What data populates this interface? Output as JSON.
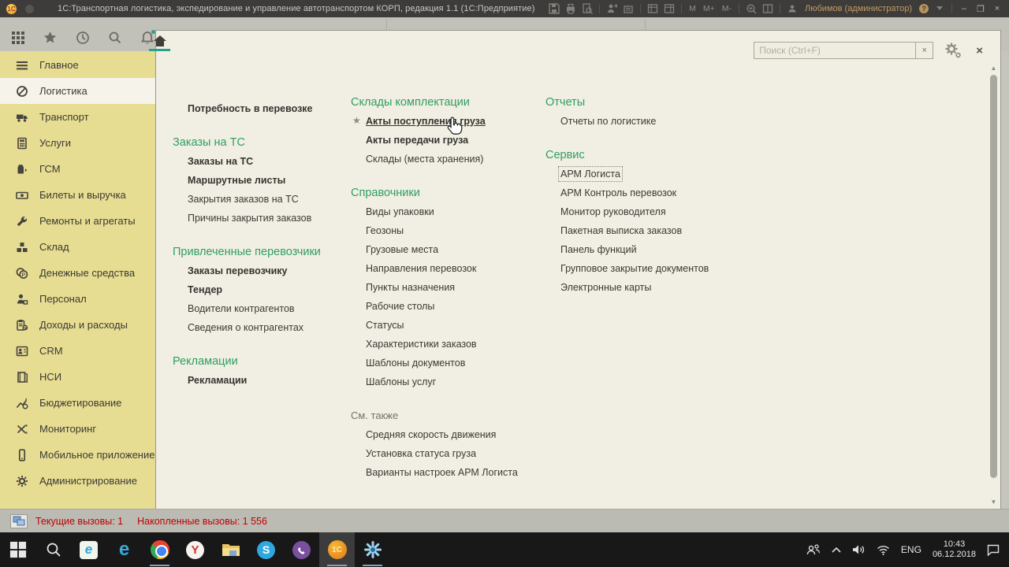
{
  "titlebar": {
    "logo": "1С",
    "title": "1С:Транспортная логистика, экспедирование и управление автотранспортом КОРП, редакция 1.1  (1С:Предприятие)",
    "memory_buttons": [
      "M",
      "M+",
      "M-"
    ],
    "user": "Любимов (администратор)",
    "help": "?",
    "minimize": "–",
    "maximize": "❒",
    "close": "×"
  },
  "panel": {
    "search_placeholder": "Поиск (Ctrl+F)",
    "search_clear": "×",
    "close": "×",
    "scroll_up": "▲",
    "scroll_down": "▼"
  },
  "sidebar": [
    {
      "label": "Главное",
      "icon": "menu-icon"
    },
    {
      "label": "Логистика",
      "icon": "compass-icon",
      "selected": true
    },
    {
      "label": "Транспорт",
      "icon": "truck-icon"
    },
    {
      "label": "Услуги",
      "icon": "calculator-icon"
    },
    {
      "label": "ГСМ",
      "icon": "fuel-icon"
    },
    {
      "label": "Билеты и выручка",
      "icon": "ticket-icon"
    },
    {
      "label": "Ремонты и агрегаты",
      "icon": "wrench-icon"
    },
    {
      "label": "Склад",
      "icon": "pallet-icon"
    },
    {
      "label": "Денежные средства",
      "icon": "coins-icon"
    },
    {
      "label": "Персонал",
      "icon": "person-icon"
    },
    {
      "label": "Доходы и расходы",
      "icon": "ledger-icon"
    },
    {
      "label": "CRM",
      "icon": "contact-card-icon"
    },
    {
      "label": "НСИ",
      "icon": "books-icon"
    },
    {
      "label": "Бюджетирование",
      "icon": "budget-chart-icon"
    },
    {
      "label": "Мониторинг",
      "icon": "monitoring-icon"
    },
    {
      "label": "Мобильное приложение",
      "icon": "mobile-phone-icon"
    },
    {
      "label": "Администрирование",
      "icon": "gear-icon"
    }
  ],
  "menu_columns": [
    {
      "sections": [
        {
          "header": null,
          "items": [
            {
              "label": "Потребность в перевозке",
              "bold": true
            }
          ]
        },
        {
          "header": "Заказы на ТС",
          "items": [
            {
              "label": "Заказы на ТС",
              "bold": true
            },
            {
              "label": "Маршрутные листы",
              "bold": true
            },
            {
              "label": "Закрытия заказов на ТС"
            },
            {
              "label": "Причины закрытия заказов"
            }
          ]
        },
        {
          "header": "Привлеченные перевозчики",
          "items": [
            {
              "label": "Заказы перевозчику",
              "bold": true
            },
            {
              "label": "Тендер",
              "bold": true
            },
            {
              "label": "Водители контрагентов"
            },
            {
              "label": "Сведения о контрагентах"
            }
          ]
        },
        {
          "header": "Рекламации",
          "items": [
            {
              "label": "Рекламации",
              "bold": true
            }
          ]
        }
      ]
    },
    {
      "sections": [
        {
          "header": "Склады комплектации",
          "items": [
            {
              "label": "Акты поступления груза",
              "bold": true,
              "starred": true,
              "underlined": true
            },
            {
              "label": "Акты передачи груза",
              "bold": true
            },
            {
              "label": "Склады (места хранения)"
            }
          ]
        },
        {
          "header": "Справочники",
          "items": [
            {
              "label": "Виды упаковки"
            },
            {
              "label": "Геозоны"
            },
            {
              "label": "Грузовые места"
            },
            {
              "label": "Направления перевозок"
            },
            {
              "label": "Пункты назначения"
            },
            {
              "label": "Рабочие столы"
            },
            {
              "label": "Статусы"
            },
            {
              "label": "Характеристики заказов"
            },
            {
              "label": "Шаблоны документов"
            },
            {
              "label": "Шаблоны услуг"
            }
          ]
        },
        {
          "header": "См. также",
          "muted": true,
          "items": [
            {
              "label": "Средняя скорость движения"
            },
            {
              "label": "Установка статуса груза"
            },
            {
              "label": "Варианты настроек АРМ Логиста"
            }
          ]
        }
      ]
    },
    {
      "sections": [
        {
          "header": "Отчеты",
          "items": [
            {
              "label": "Отчеты по логистике"
            }
          ]
        },
        {
          "header": "Сервис",
          "items": [
            {
              "label": "АРМ Логиста",
              "focused": true
            },
            {
              "label": "АРМ Контроль перевозок"
            },
            {
              "label": "Монитор руководителя"
            },
            {
              "label": "Пакетная выписка заказов"
            },
            {
              "label": "Панель функций"
            },
            {
              "label": "Групповое закрытие документов"
            },
            {
              "label": "Электронные карты"
            }
          ]
        }
      ]
    }
  ],
  "statusbar": {
    "current": "Текущие вызовы: 1",
    "accumulated": "Накопленные вызовы: 1 556"
  },
  "taskbar": {
    "apps": [
      {
        "icon": "start"
      },
      {
        "icon": "search"
      },
      {
        "icon": "ie"
      },
      {
        "icon": "edge"
      },
      {
        "icon": "chrome",
        "active": true
      },
      {
        "icon": "yandex"
      },
      {
        "icon": "explorer"
      },
      {
        "icon": "skype"
      },
      {
        "icon": "viber"
      },
      {
        "icon": "onec",
        "active": true,
        "tile": true
      },
      {
        "icon": "snowflake-app",
        "active": true
      }
    ],
    "lang": "ENG",
    "time": "10:43",
    "date": "06.12.2018"
  },
  "colors": {
    "accent_green": "#2f9e62",
    "sidebar_yellow": "#e7dd92",
    "panel_bg": "#f1efe3",
    "status_red": "#c00000",
    "home_underline": "#2aa08b"
  }
}
